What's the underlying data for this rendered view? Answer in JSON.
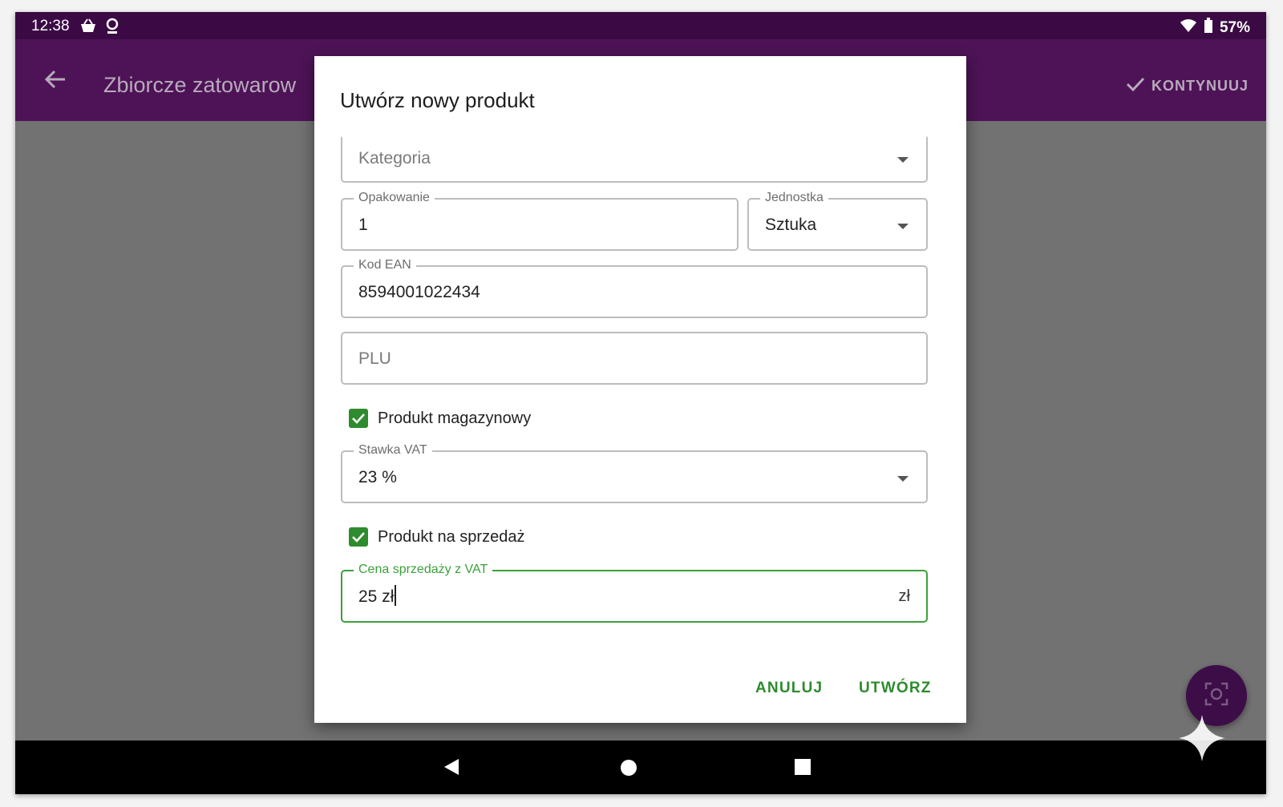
{
  "status_bar": {
    "time": "12:38",
    "battery": "57%",
    "icons": [
      "basket-icon",
      "location-icon",
      "wifi-icon",
      "battery-icon"
    ]
  },
  "app_bar": {
    "title": "Zbiorcze zatowarow",
    "continue_label": "KONTYNUUJ"
  },
  "dialog": {
    "title": "Utwórz nowy produkt",
    "category": {
      "placeholder": "Kategoria"
    },
    "packaging": {
      "label": "Opakowanie",
      "value": "1"
    },
    "unit": {
      "label": "Jednostka",
      "value": "Sztuka"
    },
    "ean": {
      "label": "Kod EAN",
      "value": "8594001022434"
    },
    "plu": {
      "placeholder": "PLU"
    },
    "stock_product": {
      "label": "Produkt magazynowy",
      "checked": true
    },
    "vat": {
      "label": "Stawka VAT",
      "value": "23 %"
    },
    "for_sale": {
      "label": "Produkt na sprzedaż",
      "checked": true
    },
    "price": {
      "label": "Cena sprzedaży z VAT",
      "value": "25 zł",
      "suffix": "zł"
    },
    "cancel_label": "ANULUJ",
    "create_label": "UTWÓRZ"
  },
  "colors": {
    "accent": "#2e8b2e",
    "app_bar": "#4d1356",
    "status_bar": "#3b0a45",
    "scrim": "#727272"
  }
}
